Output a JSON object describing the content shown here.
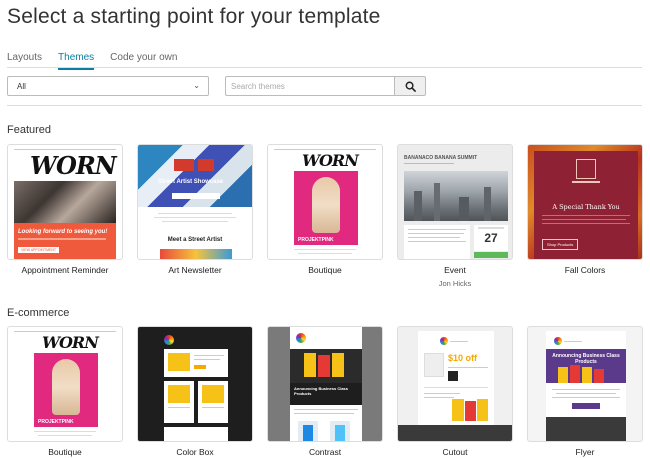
{
  "page": {
    "title": "Select a starting point for your template"
  },
  "tabs": [
    {
      "label": "Layouts",
      "active": false
    },
    {
      "label": "Themes",
      "active": true
    },
    {
      "label": "Code your own",
      "active": false
    }
  ],
  "filters": {
    "category_value": "All",
    "search_placeholder": "Search themes",
    "search_icon": "magnifier-icon"
  },
  "sections": [
    {
      "title": "Featured",
      "cards": [
        {
          "label": "Appointment Reminder",
          "thumb_text": "WORN",
          "banner_text": "Looking forward to seeing you!",
          "button_text": "VIEW APPOINTMENT"
        },
        {
          "label": "Art Newsletter",
          "thumb_title": "Street Artist Showcase",
          "thumb_sub": "Meet a Street Artist"
        },
        {
          "label": "Boutique",
          "thumb_text": "WORN",
          "banner_text": "PROJEKTPINK"
        },
        {
          "label": "Event",
          "sub": "Jon Hicks",
          "thumb_title": "BANANACO BANANA SUMMIT",
          "date_day": "27"
        },
        {
          "label": "Fall Colors",
          "thumb_title": "A Special Thank You",
          "button_text": "Shop Products"
        }
      ]
    },
    {
      "title": "E-commerce",
      "cards": [
        {
          "label": "Boutique",
          "thumb_text": "WORN",
          "banner_text": "PROJEKTPINK"
        },
        {
          "label": "Color Box"
        },
        {
          "label": "Contrast",
          "thumb_title": "Announcing Business Class Products"
        },
        {
          "label": "Cutout",
          "price": "$10 off"
        },
        {
          "label": "Flyer",
          "thumb_title": "Announcing Business Class Products"
        }
      ]
    }
  ],
  "colors": {
    "accent": "#0a7ea4",
    "coral": "#ef5a3c",
    "magenta": "#e0297f",
    "maroon": "#8e2234",
    "event_green": "#5fb85a",
    "dark": "#222222",
    "purple": "#5b3a8c"
  }
}
